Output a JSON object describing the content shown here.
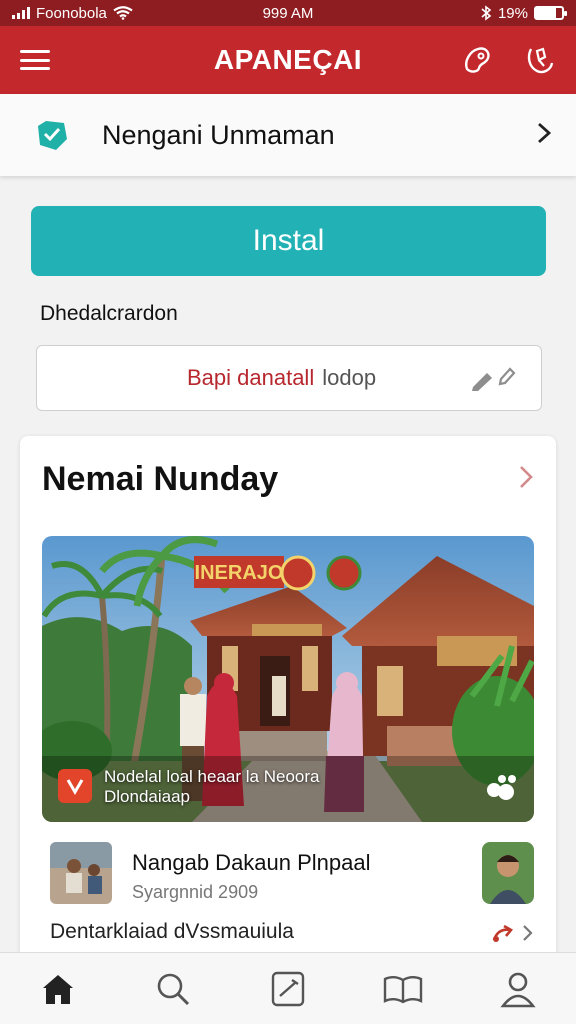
{
  "status_bar": {
    "carrier": "Foonobola",
    "time": "999 AM",
    "battery": "19%",
    "battery_level": 0.75
  },
  "app_bar": {
    "title": "APANEÇAI"
  },
  "user": {
    "name": "Nengani Unmaman"
  },
  "install": {
    "label": "Instal"
  },
  "field": {
    "label": "Dhedalcrardon",
    "value_primary": "Bapi danatall",
    "value_secondary": "lodop"
  },
  "card": {
    "title": "Nemai Nunday",
    "hero": {
      "sign": "INERAJO",
      "caption_line1": "Nodelal loal heaar la Neoora",
      "caption_line2": "Dlondaiaap"
    },
    "post": {
      "title": "Nangab Dakaun Plnpaal",
      "meta": "Syargnnid 2909"
    },
    "footer_text": "Dentarklaiad dVssmauiula"
  },
  "colors": {
    "brand_red": "#c3282d",
    "status_dark": "#8e1d22",
    "teal": "#22b2b5"
  },
  "tabs": [
    {
      "icon": "home-icon"
    },
    {
      "icon": "search-icon"
    },
    {
      "icon": "edit-icon"
    },
    {
      "icon": "book-icon"
    },
    {
      "icon": "profile-icon"
    }
  ]
}
